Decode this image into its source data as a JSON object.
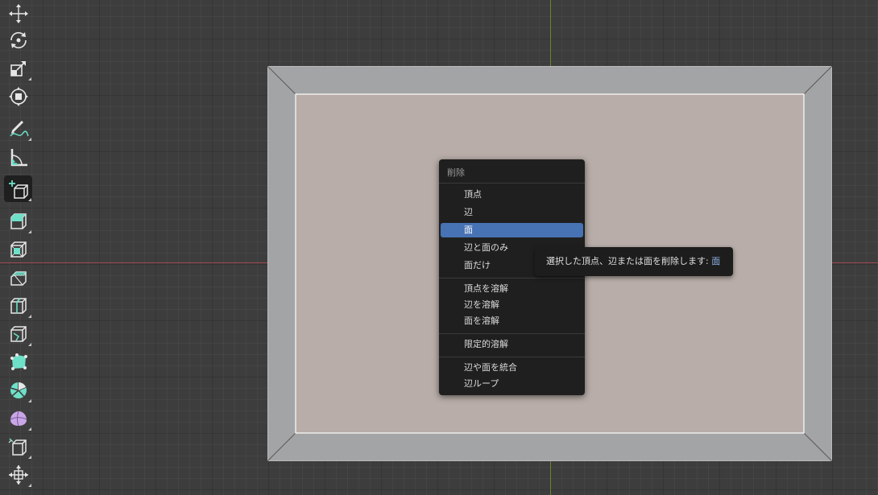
{
  "viewport": {
    "colors": {
      "background": "#3d3d3d",
      "x_axis": "#b34a52",
      "y_axis": "#6e8f2a",
      "face_selected": "#b8ada8",
      "face_frame": "#a3a4a6"
    }
  },
  "toolbar": {
    "tools": [
      {
        "name": "move-icon",
        "active": false
      },
      {
        "name": "rotate-icon",
        "active": false
      },
      {
        "name": "scale-icon",
        "active": false
      },
      {
        "name": "transform-icon",
        "active": false
      },
      {
        "name": "annotate-icon",
        "active": false
      },
      {
        "name": "measure-icon",
        "active": false
      },
      {
        "name": "add-cube-icon",
        "active": true
      },
      {
        "name": "extrude-region-icon",
        "active": false
      },
      {
        "name": "inset-faces-icon",
        "active": false
      },
      {
        "name": "bevel-icon",
        "active": false
      },
      {
        "name": "loop-cut-icon",
        "active": false
      },
      {
        "name": "knife-icon",
        "active": false
      },
      {
        "name": "poly-build-icon",
        "active": false
      },
      {
        "name": "spin-icon",
        "active": false
      },
      {
        "name": "smooth-icon",
        "active": false
      },
      {
        "name": "edge-slide-icon",
        "active": false
      },
      {
        "name": "shrink-fatten-icon",
        "active": false
      }
    ]
  },
  "menu": {
    "title": "削除",
    "groups": [
      [
        "頂点",
        "辺",
        "面",
        "辺と面のみ",
        "面だけ"
      ],
      [
        "頂点を溶解",
        "辺を溶解",
        "面を溶解"
      ],
      [
        "限定的溶解"
      ],
      [
        "辺や面を統合",
        "辺ループ"
      ]
    ],
    "highlighted_item": "面",
    "colors": {
      "background": "#1f1f1f",
      "highlight": "#4772b3"
    }
  },
  "tooltip": {
    "text": "選択した頂点、辺または面を削除します: ",
    "value": "面"
  }
}
